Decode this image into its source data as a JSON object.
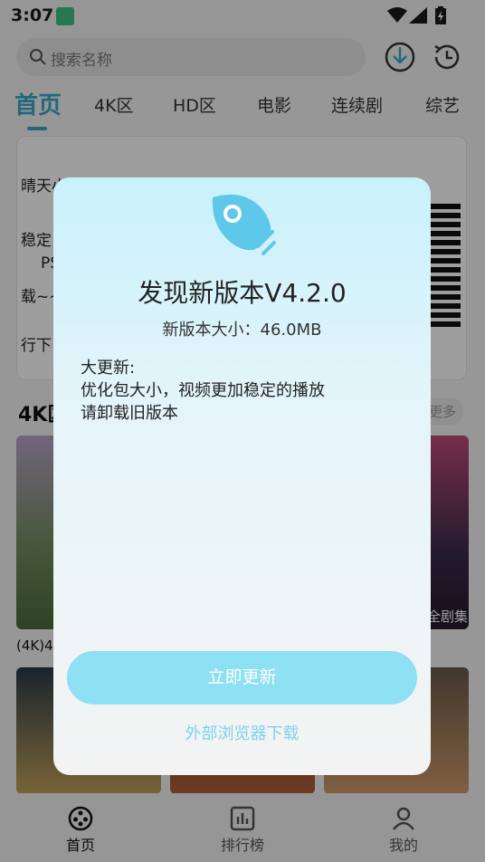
{
  "status_bar": {
    "time": "3:07"
  },
  "search": {
    "placeholder": "搜索名称"
  },
  "tabs": [
    {
      "label": "首页"
    },
    {
      "label": "4K区"
    },
    {
      "label": "HD区"
    },
    {
      "label": "电影"
    },
    {
      "label": "连续剧"
    },
    {
      "label": "综艺"
    }
  ],
  "background": {
    "notice_lines": [
      "晴天小",
      "稳定",
      "PS",
      "载~~",
      "行下"
    ],
    "section_title": "4K区",
    "more": "更多",
    "poster_label": "(4K)4",
    "poster_tag": "全剧集"
  },
  "bottom_nav": [
    {
      "label": "首页"
    },
    {
      "label": "排行榜"
    },
    {
      "label": "我的"
    }
  ],
  "dialog": {
    "title": "发现新版本V4.2.0",
    "size_text": "新版本大小：46.0MB",
    "changelog": [
      "大更新:",
      "优化包大小，视频更加稳定的播放",
      "请卸载旧版本"
    ],
    "update_button": "立即更新",
    "browser_link": "外部浏览器下载"
  },
  "colors": {
    "accent": "#3aa7c9",
    "button": "#8ee0f3",
    "link": "#7fd1ea"
  }
}
